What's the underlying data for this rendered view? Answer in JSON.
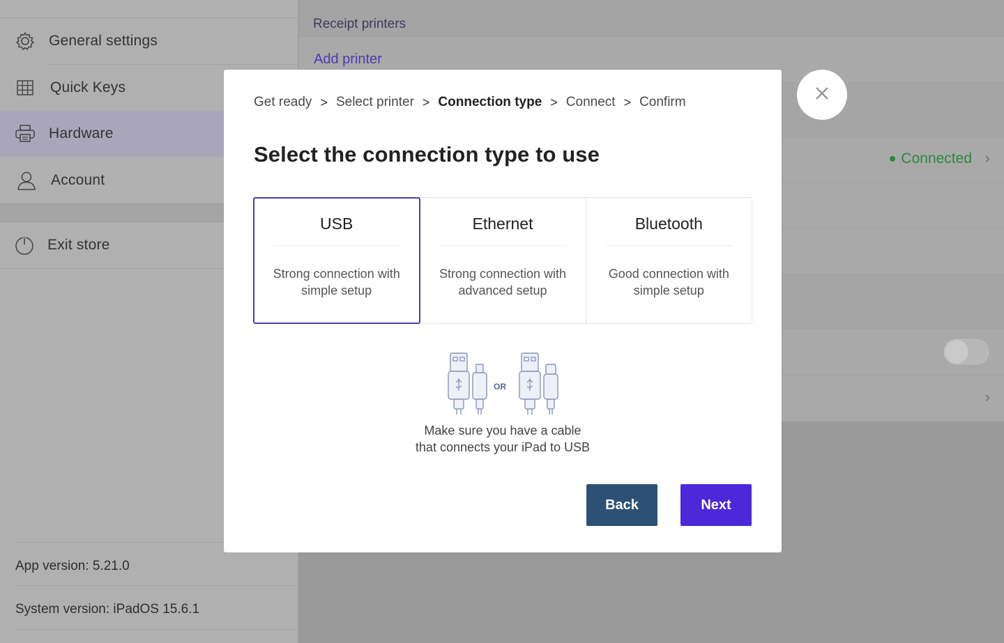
{
  "sidebar": {
    "items": [
      {
        "label": "General settings",
        "icon": "gear-icon"
      },
      {
        "label": "Quick Keys",
        "icon": "grid-icon"
      },
      {
        "label": "Hardware",
        "icon": "printer-icon"
      },
      {
        "label": "Account",
        "icon": "user-icon"
      }
    ],
    "exit": {
      "label": "Exit store",
      "icon": "power-icon"
    },
    "app_version": "App version: 5.21.0",
    "system_version": "System version: iPadOS 15.6.1"
  },
  "main": {
    "section_title": "Receipt printers",
    "add_printer": "Add printer",
    "status": "Connected",
    "status_color": "#2a8a3a"
  },
  "modal": {
    "breadcrumb": [
      "Get ready",
      "Select printer",
      "Connection type",
      "Connect",
      "Confirm"
    ],
    "current_step": "Connection type",
    "title": "Select the connection type to use",
    "options": [
      {
        "title": "USB",
        "desc": "Strong connection with simple setup",
        "selected": true
      },
      {
        "title": "Ethernet",
        "desc": "Strong connection with advanced setup",
        "selected": false
      },
      {
        "title": "Bluetooth",
        "desc": "Good connection with simple setup",
        "selected": false
      }
    ],
    "illustration_or": "OR",
    "hint_line1": "Make sure you have a cable",
    "hint_line2": "that connects your iPad to USB",
    "back_label": "Back",
    "next_label": "Next",
    "accent": "#4c28db",
    "back_color": "#2d5175"
  }
}
